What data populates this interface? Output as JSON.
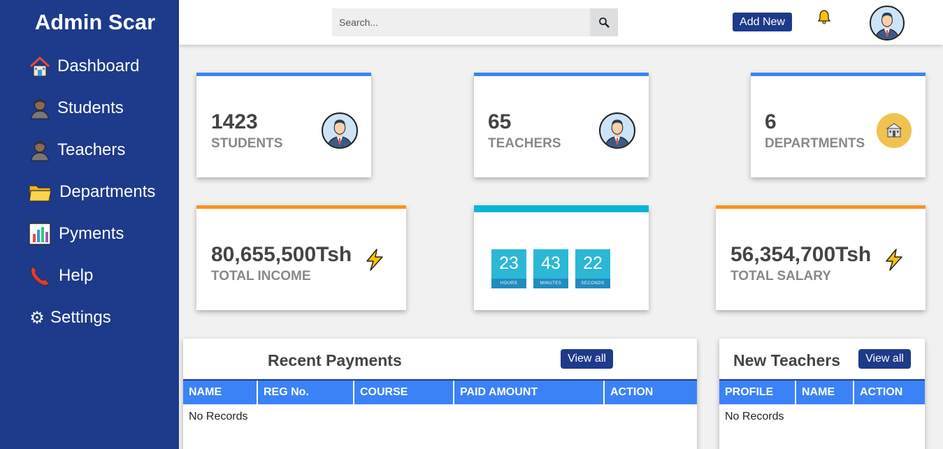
{
  "sidebar": {
    "brand": "Admin Scar",
    "items": [
      {
        "label": "Dashboard",
        "icon": "house-icon"
      },
      {
        "label": "Students",
        "icon": "person-icon"
      },
      {
        "label": "Teachers",
        "icon": "person-icon"
      },
      {
        "label": "Departments",
        "icon": "folder-icon"
      },
      {
        "label": "Pyments",
        "icon": "bar-chart-icon"
      },
      {
        "label": "Help",
        "icon": "phone-icon"
      },
      {
        "label": "Settings",
        "icon": "gear-icon"
      }
    ]
  },
  "topbar": {
    "search_placeholder": "Search...",
    "add_new_label": "Add New",
    "bell_icon": "bell-icon",
    "avatar_icon": "user-avatar"
  },
  "stats": {
    "students": {
      "value": "1423",
      "label": "STUDENTS"
    },
    "teachers": {
      "value": "65",
      "label": "TEACHERS"
    },
    "departments": {
      "value": "6",
      "label": "DEPARTMENTS"
    },
    "income": {
      "value": "80,655,500Tsh",
      "label": "TOTAL INCOME"
    },
    "salary": {
      "value": "56,354,700Tsh",
      "label": "TOTAL SALARY"
    }
  },
  "clock": {
    "hours": "23",
    "hours_label": "HOURS",
    "minutes": "43",
    "minutes_label": "MINUTES",
    "seconds": "22",
    "seconds_label": "SECONDS"
  },
  "recent_payments": {
    "title": "Recent Payments",
    "view_all": "View all",
    "columns": [
      "NAME",
      "REG No.",
      "COURSE",
      "PAID AMOUNT",
      "ACTION"
    ],
    "empty": "No Records"
  },
  "new_teachers": {
    "title": "New Teachers",
    "view_all": "View all",
    "columns": [
      "PROFILE",
      "NAME",
      "ACTION"
    ],
    "empty": "No Records"
  },
  "colors": {
    "sidebar": "#1e3a8a",
    "card_blue": "#3b82f6",
    "card_orange": "#f7941d",
    "card_cyan": "#06b6d4",
    "table_header": "#3b82f6"
  }
}
